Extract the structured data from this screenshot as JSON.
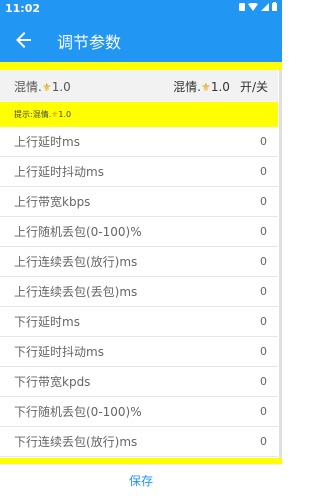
{
  "status_bar": {
    "time": "11:02",
    "icons": [
      "sim-icon",
      "wifi-icon",
      "signal-icon",
      "battery-icon"
    ]
  },
  "app_bar": {
    "title": "调节参数"
  },
  "header": {
    "name_prefix": "混情.",
    "name_suffix": "1.0",
    "right_prefix": "混情.",
    "right_suffix": "1.0",
    "toggle_label": "开/关"
  },
  "hint": {
    "prefix": "提示:混情.",
    "suffix": "1.0"
  },
  "rows": [
    {
      "label": "上行延时ms",
      "value": "0"
    },
    {
      "label": "上行延时抖动ms",
      "value": "0"
    },
    {
      "label": "上行带宽kbps",
      "value": "0"
    },
    {
      "label": "上行随机丢包(0-100)%",
      "value": "0"
    },
    {
      "label": "上行连续丢包(放行)ms",
      "value": "0"
    },
    {
      "label": "上行连续丢包(丢包)ms",
      "value": "0"
    },
    {
      "label": "下行延时ms",
      "value": "0"
    },
    {
      "label": "下行延时抖动ms",
      "value": "0"
    },
    {
      "label": "下行带宽kpds",
      "value": "0"
    },
    {
      "label": "下行随机丢包(0-100)%",
      "value": "0"
    },
    {
      "label": "下行连续丢包(放行)ms",
      "value": "0"
    }
  ],
  "save_label": "保存",
  "colors": {
    "primary": "#2196f3",
    "highlight": "#ffff00"
  }
}
